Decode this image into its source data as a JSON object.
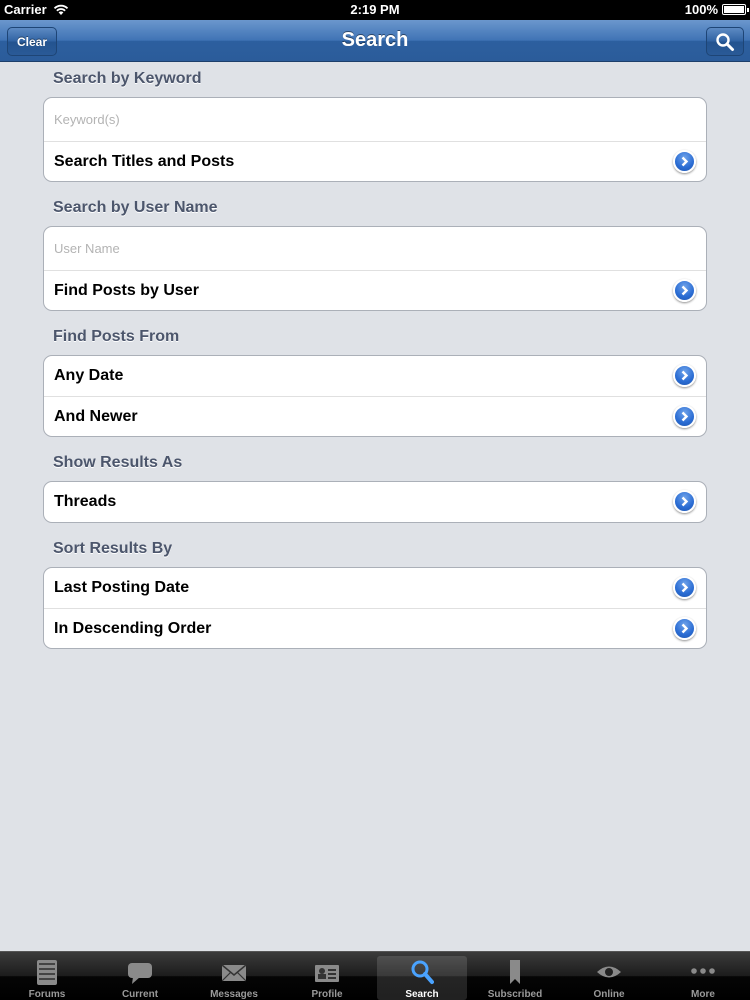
{
  "status_bar": {
    "carrier": "Carrier",
    "time": "2:19 PM",
    "battery": "100%",
    "battery_level": 1.0
  },
  "nav": {
    "title": "Search",
    "clear_label": "Clear",
    "search_icon": "search-icon"
  },
  "sections": {
    "keyword": {
      "header": "Search by Keyword",
      "input_placeholder": "Keyword(s)",
      "action_label": "Search Titles and Posts"
    },
    "username": {
      "header": "Search by User Name",
      "input_placeholder": "User Name",
      "action_label": "Find Posts by User"
    },
    "date": {
      "header": "Find Posts From",
      "rows": [
        "Any Date",
        "And Newer"
      ]
    },
    "results": {
      "header": "Show Results As",
      "rows": [
        "Threads"
      ]
    },
    "sort": {
      "header": "Sort Results By",
      "rows": [
        "Last Posting Date",
        "In Descending Order"
      ]
    }
  },
  "tabs": [
    {
      "label": "Forums",
      "icon": "forums-icon"
    },
    {
      "label": "Current",
      "icon": "speech-bubble-icon"
    },
    {
      "label": "Messages",
      "icon": "envelope-icon"
    },
    {
      "label": "Profile",
      "icon": "profile-card-icon"
    },
    {
      "label": "Search",
      "icon": "search-icon",
      "active": true
    },
    {
      "label": "Subscribed",
      "icon": "bookmark-icon"
    },
    {
      "label": "Online",
      "icon": "eye-icon"
    },
    {
      "label": "More",
      "icon": "more-dots-icon"
    }
  ],
  "colors": {
    "nav_blue": "#3f73b5",
    "background": "#dfe2e7",
    "disclosure_blue": "#2a6cd3"
  }
}
